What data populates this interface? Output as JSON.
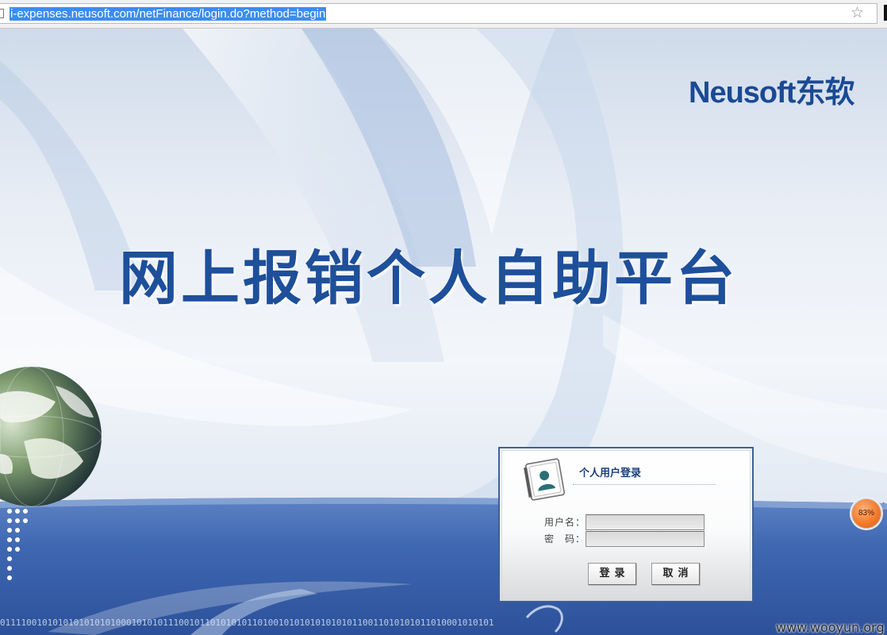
{
  "browser": {
    "url": "i-expenses.neusoft.com/netFinance/login.do?method=begin",
    "bookmark_icon": "star-icon"
  },
  "page": {
    "brand": "Neusoft东软",
    "title": "网上报销个人自助平台",
    "binary_text": "0111100101010101010101000101010111001011010101011010010101010101010110011010101011010001010101"
  },
  "login": {
    "heading": "个人用户登录",
    "username_label": "用户名：",
    "username_value": "",
    "password_label": "密　码：",
    "password_value": "",
    "login_button": "登录",
    "cancel_button": "取消",
    "icon": "user-card-icon"
  },
  "widget": {
    "speed_percent": "83%",
    "up_arrow": "↑",
    "down_arrow": "↓"
  },
  "watermark": "www.wooyun.org",
  "colors": {
    "title_blue": "#1e4f9a",
    "brand_blue": "#1b4a94",
    "panel_border": "#3e5f93",
    "url_highlight": "#3b8cf4",
    "widget_orange": "#f47a2c"
  }
}
